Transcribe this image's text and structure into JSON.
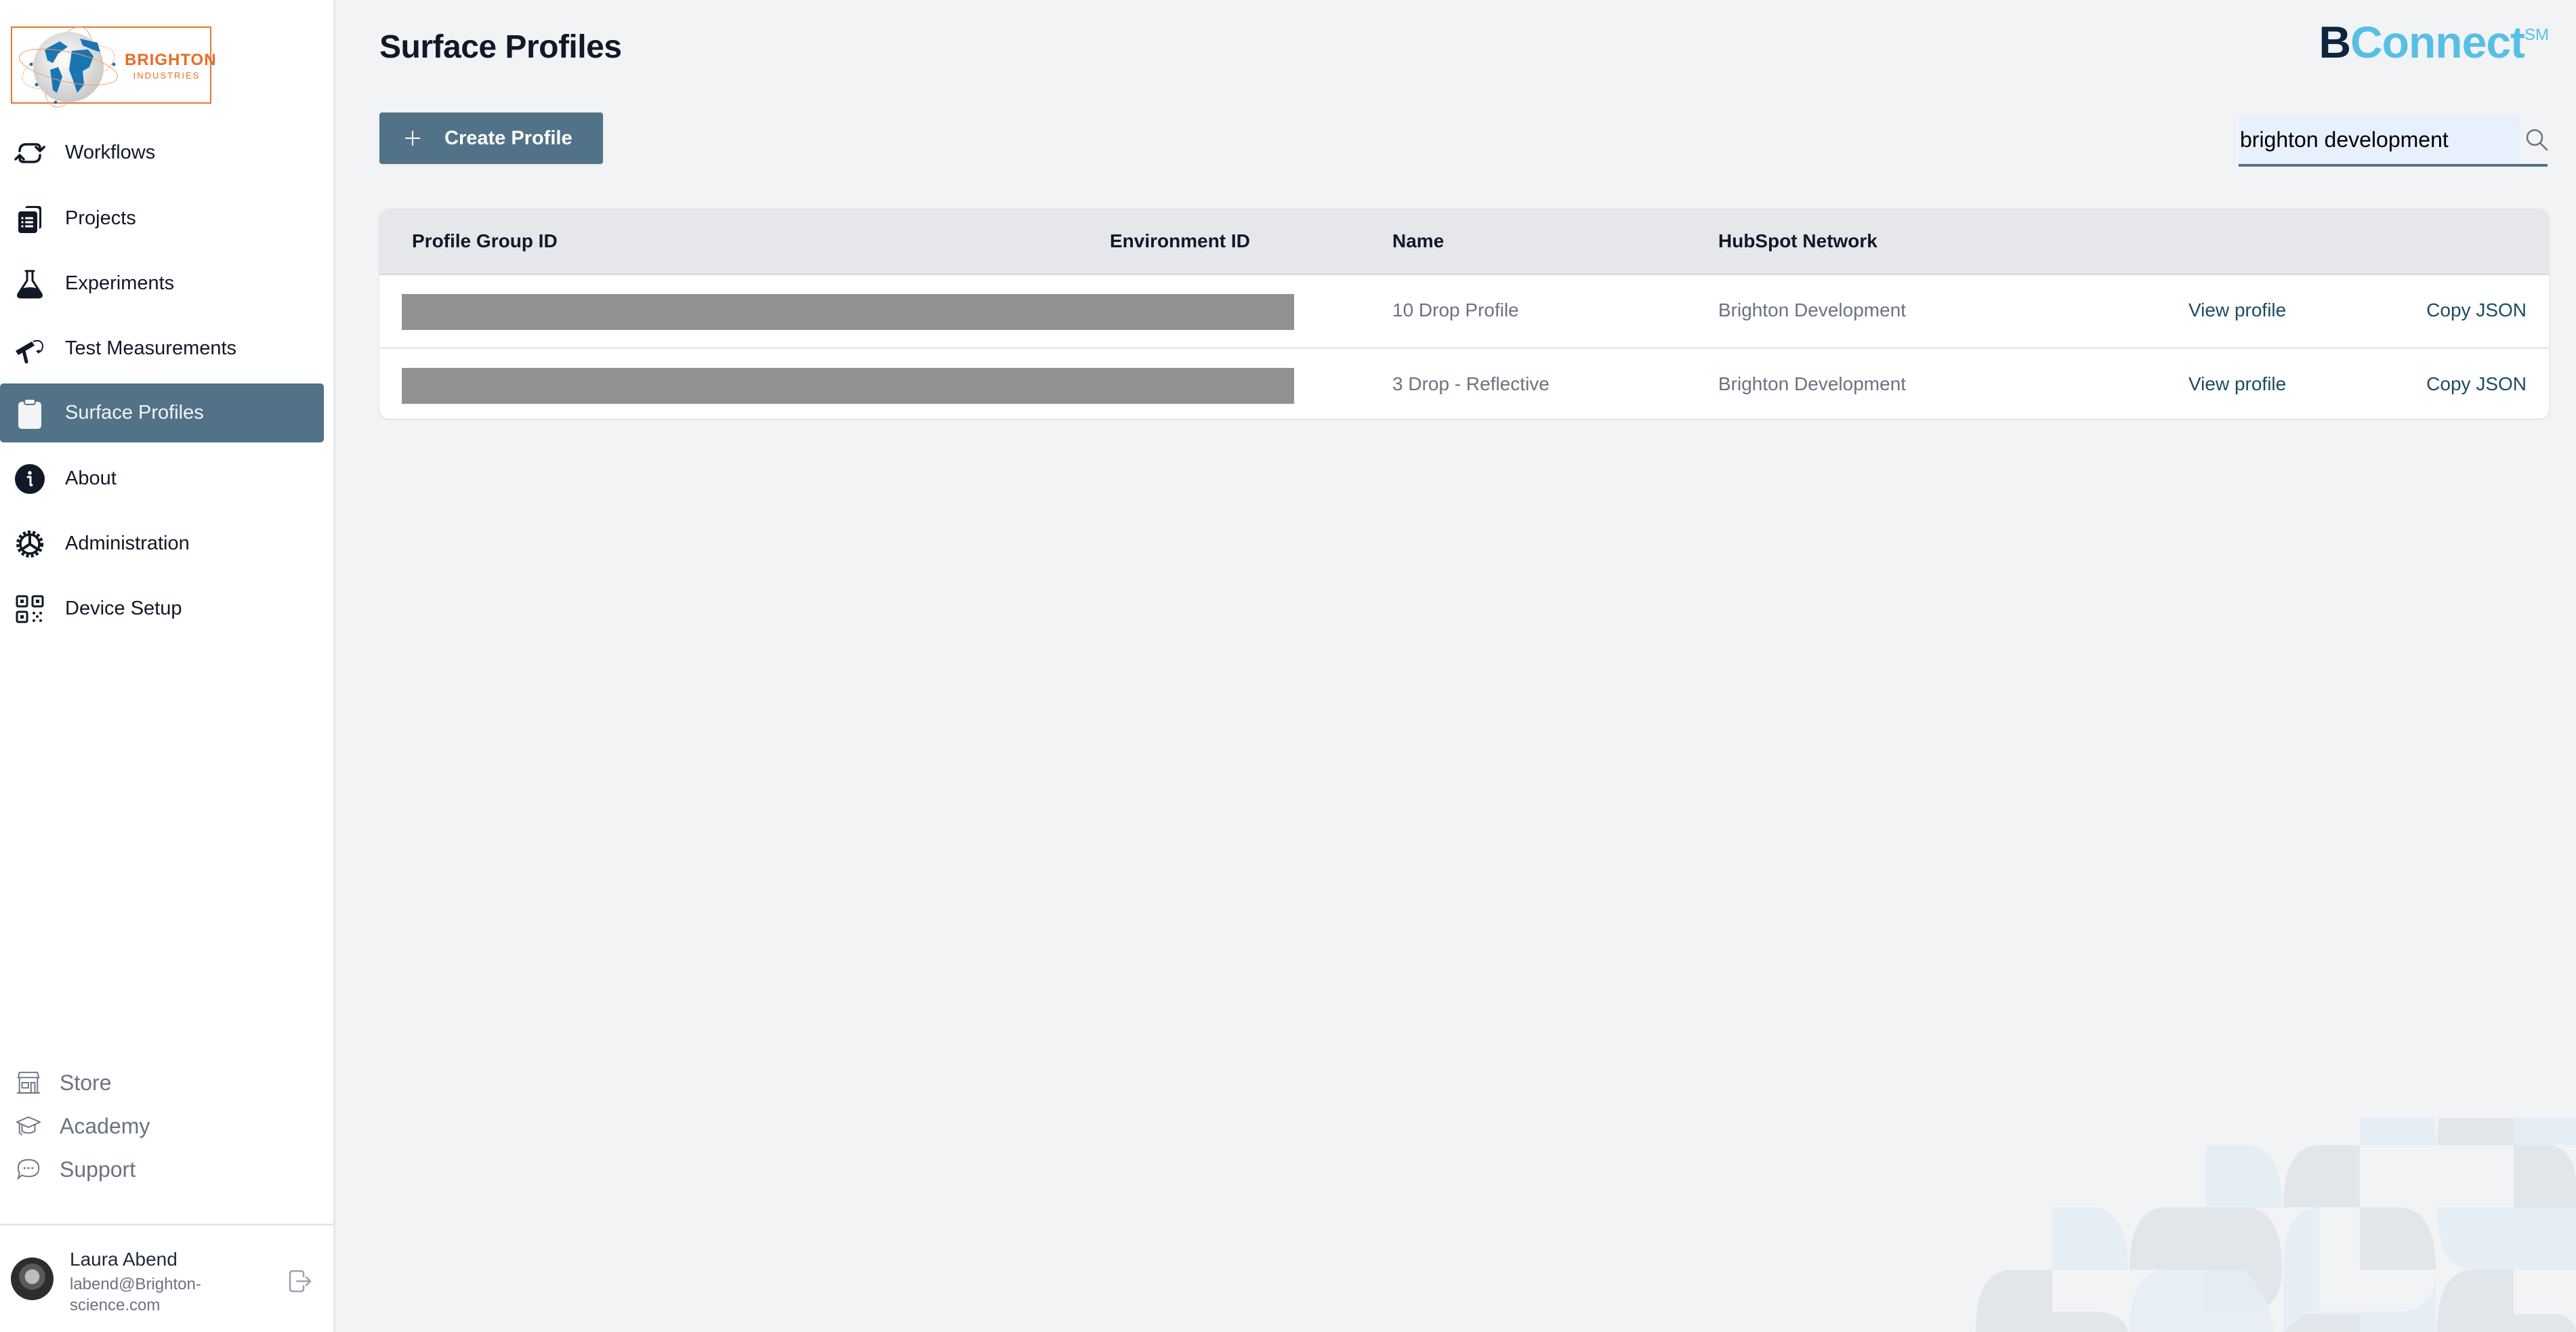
{
  "sidebar": {
    "logo": {
      "line1": "BRIGHTON",
      "line2": "INDUSTRIES"
    },
    "nav": [
      {
        "label": "Workflows",
        "icon": "workflow-cycle-icon",
        "active": false
      },
      {
        "label": "Projects",
        "icon": "projects-clipboard-icon",
        "active": false
      },
      {
        "label": "Experiments",
        "icon": "flask-icon",
        "active": false
      },
      {
        "label": "Test Measurements",
        "icon": "measurement-device-icon",
        "active": false
      },
      {
        "label": "Surface Profiles",
        "icon": "clipboard-icon",
        "active": true
      },
      {
        "label": "About",
        "icon": "info-icon",
        "active": false
      },
      {
        "label": "Administration",
        "icon": "gear-icon",
        "active": false
      },
      {
        "label": "Device Setup",
        "icon": "qr-code-icon",
        "active": false
      }
    ],
    "secondary": [
      {
        "label": "Store",
        "icon": "store-icon"
      },
      {
        "label": "Academy",
        "icon": "graduation-cap-icon"
      },
      {
        "label": "Support",
        "icon": "chat-bubble-icon"
      }
    ],
    "user": {
      "name": "Laura Abend",
      "email": "labend@Brighton-science.com"
    }
  },
  "header": {
    "title": "Surface Profiles",
    "brand": {
      "prefix": "B",
      "main": "Connect",
      "mark": "SM"
    },
    "create_button_label": "Create Profile",
    "search": {
      "value": "brighton development",
      "placeholder": ""
    }
  },
  "colors": {
    "accent": "#527387",
    "link": "#1e4b5f",
    "brand_dark": "#0d253f",
    "brand_light": "#58bfe4",
    "logo_orange": "#ee6a22"
  },
  "table": {
    "columns": [
      "Profile Group ID",
      "Environment ID",
      "Name",
      "HubSpot Network"
    ],
    "rows": [
      {
        "profile_group_id": "[redacted]",
        "environment_id": "[redacted]",
        "name": "10 Drop Profile",
        "network": "Brighton Development",
        "view": "View profile",
        "copy": "Copy JSON"
      },
      {
        "profile_group_id": "[redacted]",
        "environment_id": "[redacted]",
        "name": "3 Drop - Reflective",
        "network": "Brighton Development",
        "view": "View profile",
        "copy": "Copy JSON"
      }
    ]
  }
}
